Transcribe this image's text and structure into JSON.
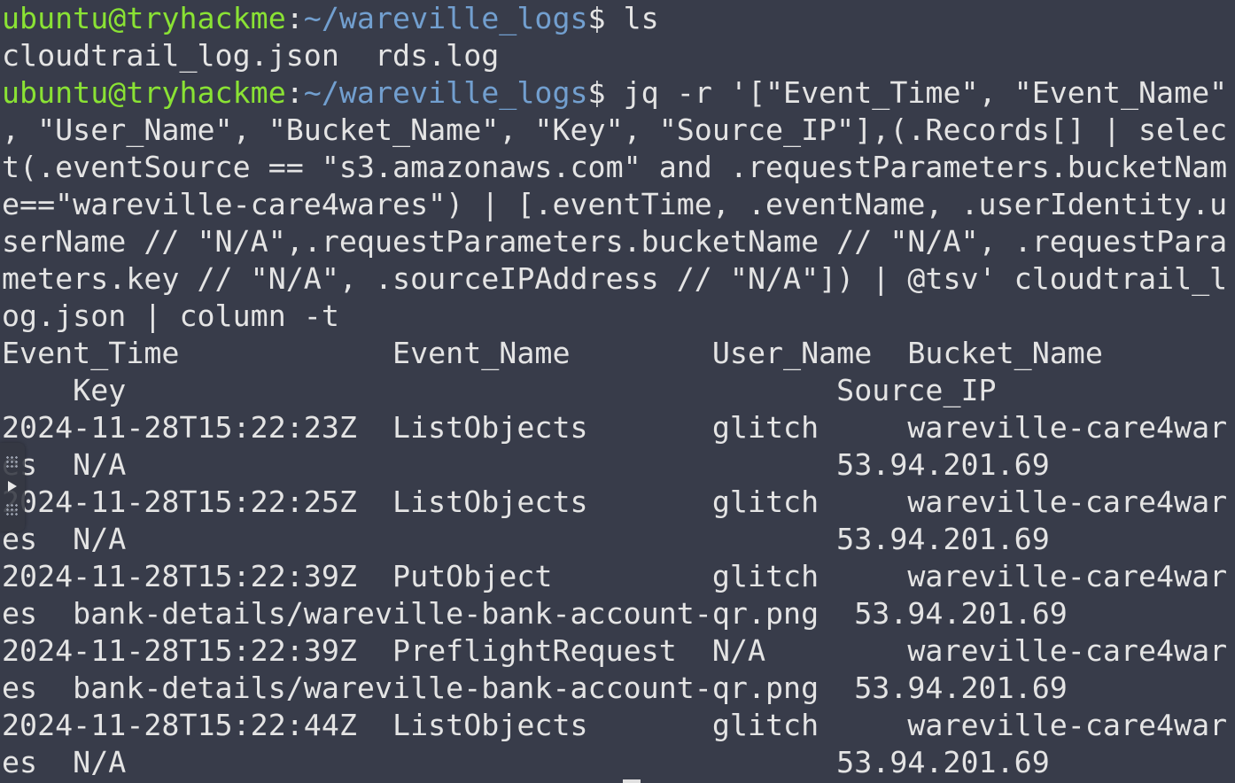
{
  "prompt": {
    "user_host": "ubuntu@tryhackme",
    "separator": ":",
    "path": "~/wareville_logs",
    "symbol": "$ "
  },
  "commands": {
    "ls": "ls",
    "jq": [
      "jq -r '[\"Event_Time\", \"Event_Name\"",
      ", \"User_Name\", \"Bucket_Name\", \"Key\", \"Source_IP\"],(.Records[] | selec",
      "t(.eventSource == \"s3.amazonaws.com\" and .requestParameters.bucketNam",
      "e==\"wareville-care4wares\") | [.eventTime, .eventName, .userIdentity.u",
      "serName // \"N/A\",.requestParameters.bucketName // \"N/A\", .requestPara",
      "meters.key // \"N/A\", .sourceIPAddress // \"N/A\"]) | @tsv' cloudtrail_l",
      "og.json | column -t"
    ]
  },
  "ls_output": "cloudtrail_log.json  rds.log",
  "table_output": [
    "Event_Time            Event_Name        User_Name  Bucket_Name",
    "    Key                                        Source_IP",
    "2024-11-28T15:22:23Z  ListObjects       glitch     wareville-care4war",
    "es  N/A                                        53.94.201.69",
    "2024-11-28T15:22:25Z  ListObjects       glitch     wareville-care4war",
    "es  N/A                                        53.94.201.69",
    "2024-11-28T15:22:39Z  PutObject         glitch     wareville-care4war",
    "es  bank-details/wareville-bank-account-qr.png  53.94.201.69",
    "2024-11-28T15:22:39Z  PreflightRequest  N/A        wareville-care4war",
    "es  bank-details/wareville-bank-account-qr.png  53.94.201.69",
    "2024-11-28T15:22:44Z  ListObjects       glitch     wareville-care4war",
    "es  N/A                                        53.94.201.69"
  ],
  "colors": {
    "background": "#383c4a",
    "text": "#e4e4e4",
    "prompt_user": "#8ae234",
    "prompt_path": "#729fcf"
  },
  "icons": {
    "side_handle": "play-icon"
  }
}
